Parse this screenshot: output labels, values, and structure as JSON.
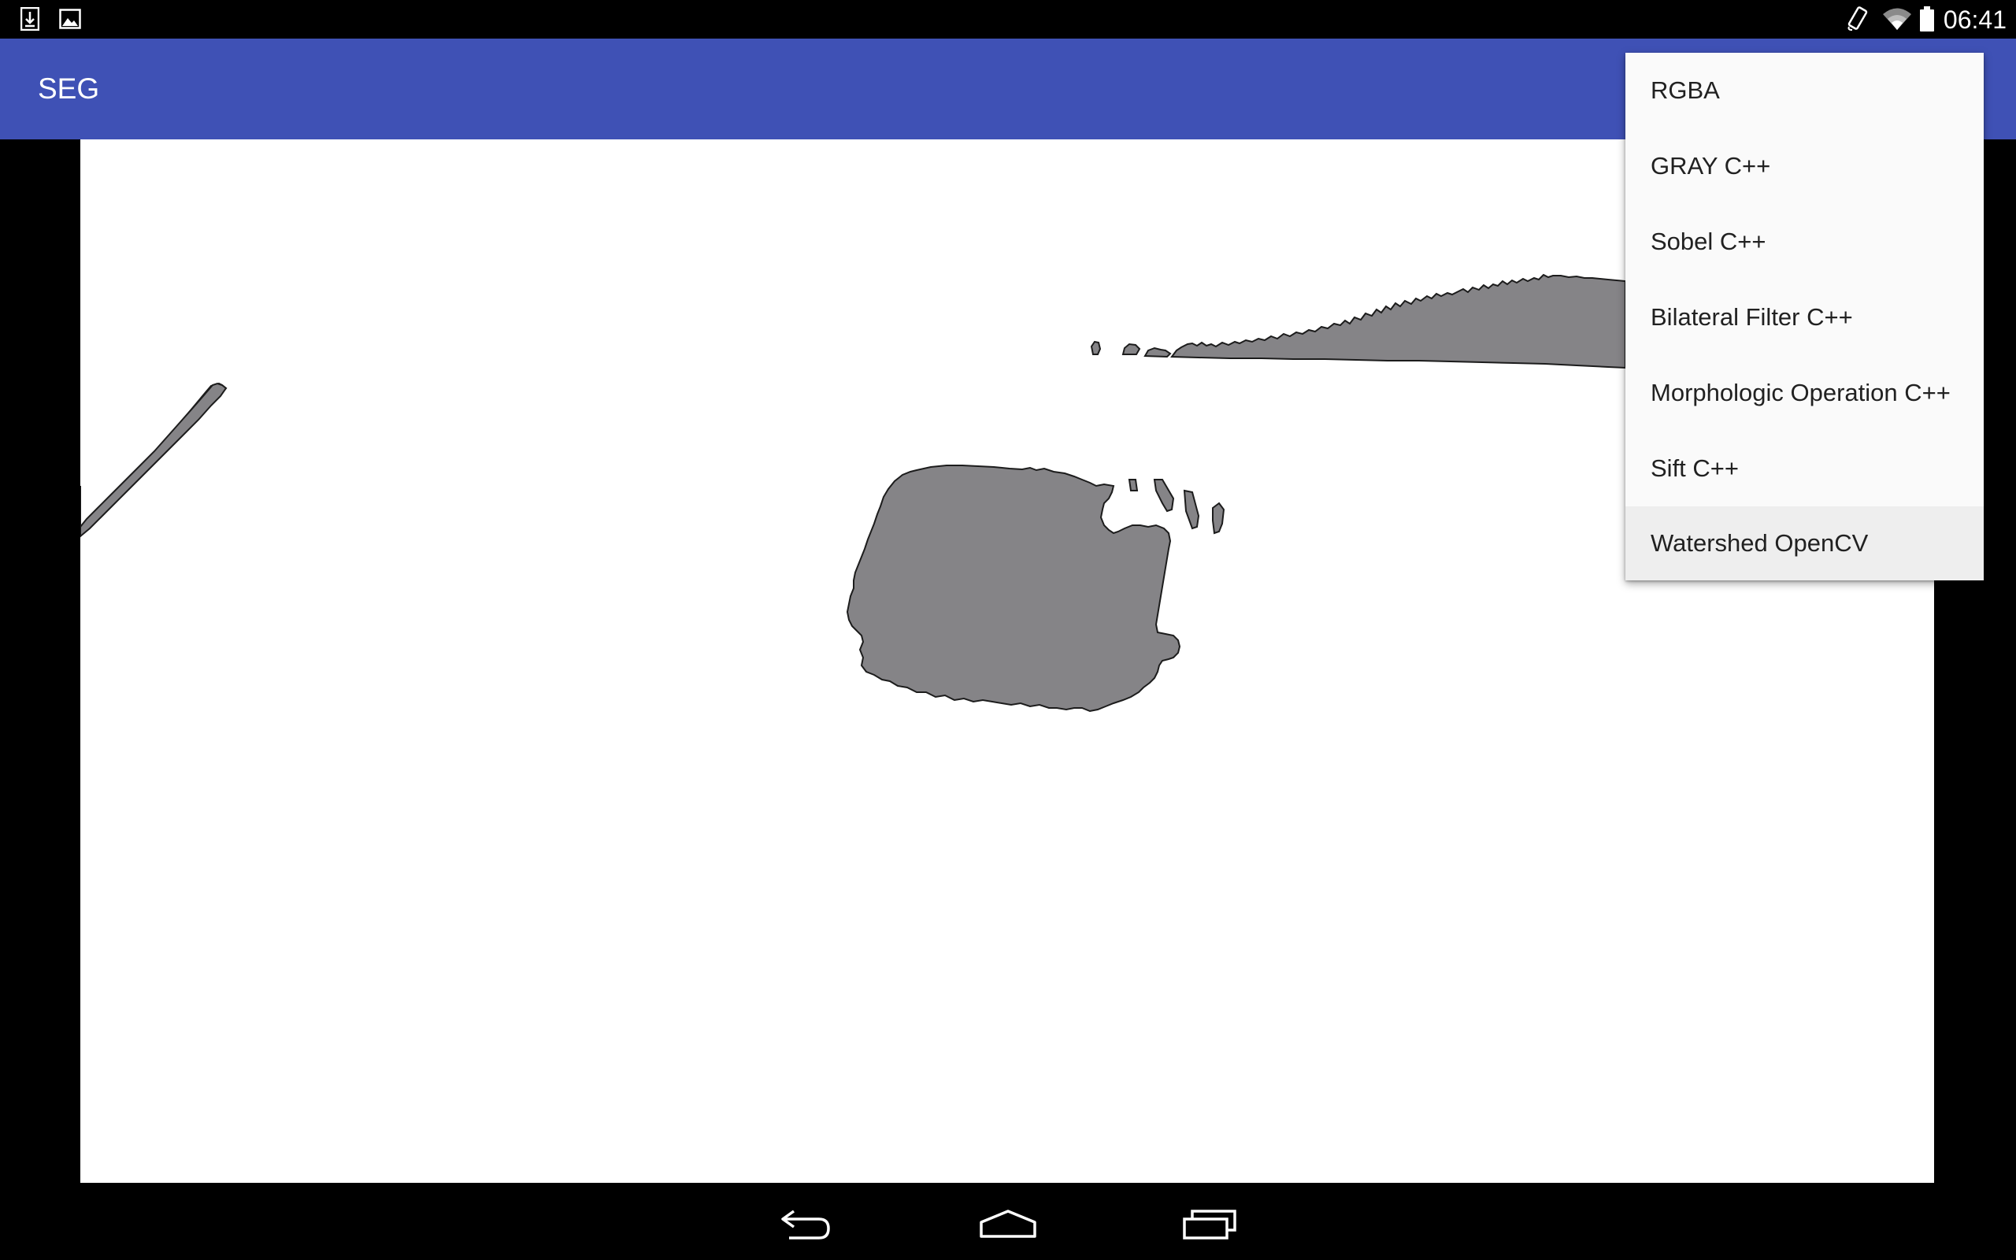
{
  "status_bar": {
    "time": "06:41",
    "left_icons": [
      "download-icon",
      "image-icon"
    ],
    "right_icons": [
      "screen-rotation-icon",
      "wifi-icon",
      "battery-icon"
    ]
  },
  "app_bar": {
    "title": "SEG",
    "color": "#3f51b5"
  },
  "menu": {
    "items": [
      {
        "label": "RGBA"
      },
      {
        "label": "GRAY C++"
      },
      {
        "label": "Sobel C++"
      },
      {
        "label": "Bilateral Filter C++"
      },
      {
        "label": "Morphologic Operation C++"
      },
      {
        "label": "Sift C++"
      },
      {
        "label": "Watershed OpenCV"
      }
    ],
    "highlighted_label": "Watershed OpenCV"
  },
  "camera_view": {
    "segment_color": "#858487",
    "background_color": "#ffffff"
  },
  "nav_bar": {
    "buttons": [
      "back-icon",
      "home-icon",
      "recent-apps-icon"
    ]
  }
}
